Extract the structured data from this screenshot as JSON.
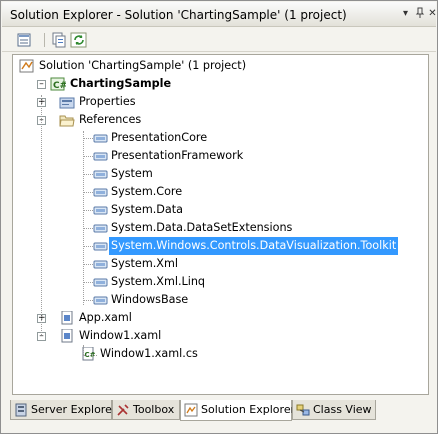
{
  "window": {
    "title": "Solution Explorer - Solution 'ChartingSample' (1 project)",
    "dropdown_glyph": "▾",
    "pin_glyph": "⊿",
    "close_glyph": "✕"
  },
  "toolbar": {
    "icons": [
      "properties-icon",
      "show-all-files-icon",
      "refresh-icon"
    ]
  },
  "tree": {
    "solution": "Solution 'ChartingSample' (1 project)",
    "project": "ChartingSample",
    "properties": "Properties",
    "references": "References",
    "reference_items": [
      "PresentationCore",
      "PresentationFramework",
      "System",
      "System.Core",
      "System.Data",
      "System.Data.DataSetExtensions",
      "System.Windows.Controls.DataVisualization.Toolkit",
      "System.Xml",
      "System.Xml.Linq",
      "WindowsBase"
    ],
    "selected_reference_index": 6,
    "app_xaml": "App.xaml",
    "window_xaml": "Window1.xaml",
    "window_xaml_cs": "Window1.xaml.cs"
  },
  "tabs": [
    {
      "label": "Server Explorer",
      "active": false
    },
    {
      "label": "Toolbox",
      "active": false
    },
    {
      "label": "Solution Explorer",
      "active": true
    },
    {
      "label": "Class View",
      "active": false
    }
  ],
  "colors": {
    "selection": "#3399ff",
    "window_bg": "#f4f3ee"
  }
}
